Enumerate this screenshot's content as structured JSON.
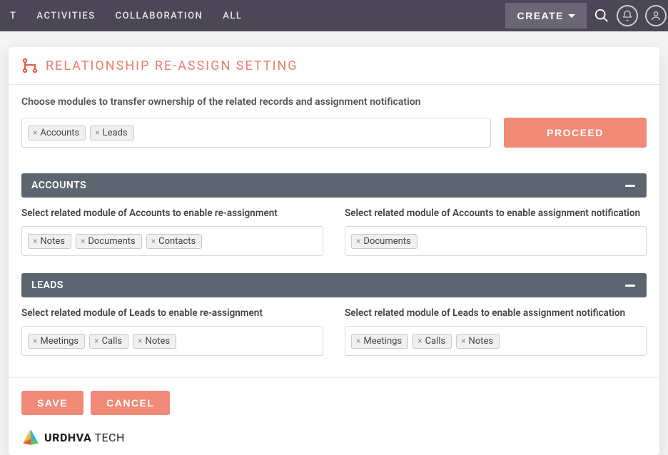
{
  "topbar": {
    "nav": [
      "T",
      "ACTIVITIES",
      "COLLABORATION",
      "ALL"
    ],
    "create_label": "CREATE"
  },
  "page": {
    "title": "RELATIONSHIP RE-ASSIGN SETTING",
    "instruction": "Choose modules to transfer ownership of the related records and assignment notification",
    "proceed_label": "PROCEED",
    "modules": [
      "Accounts",
      "Leads"
    ]
  },
  "sections": [
    {
      "title": "ACCOUNTS",
      "reassign_label": "Select related module of Accounts to enable re-assignment",
      "reassign_tags": [
        "Notes",
        "Documents",
        "Contacts"
      ],
      "notify_label": "Select related module of Accounts to enable assignment notification",
      "notify_tags": [
        "Documents"
      ]
    },
    {
      "title": "LEADS",
      "reassign_label": "Select related module of Leads to enable re-assignment",
      "reassign_tags": [
        "Meetings",
        "Calls",
        "Notes"
      ],
      "notify_label": "Select related module of Leads to enable assignment notification",
      "notify_tags": [
        "Meetings",
        "Calls",
        "Notes"
      ]
    }
  ],
  "actions": {
    "save_label": "SAVE",
    "cancel_label": "CANCEL"
  },
  "footer": {
    "brand_bold": "URDHVA",
    "brand_thin": "TECH"
  }
}
